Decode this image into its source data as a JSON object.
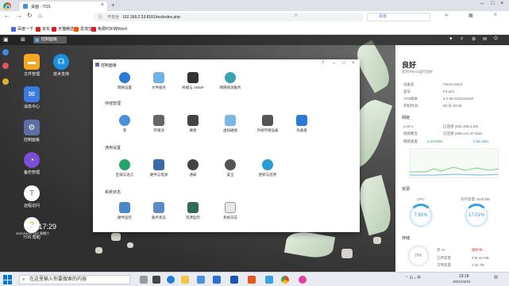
{
  "browser": {
    "tab_title": "桌面 - TOS",
    "security": "不安全",
    "url": "192.168.2.53:8181/tos/index.php",
    "search_placeholder": "百度",
    "bookmarks": [
      "百度一下",
      "京东",
      "天猫精选",
      "爱淘宝",
      "免费PDF转Word"
    ]
  },
  "os": {
    "open_app": "控制面板",
    "clock": "23:17:29",
    "date": "2021/04/24 CST 星期六",
    "desktop_icons": [
      {
        "label": "文件管理",
        "color": "#f5a623"
      },
      {
        "label": "技术支持",
        "color": "#1a8fe0"
      },
      {
        "label": "消息中心",
        "color": "#3a7be0"
      },
      {
        "label": "控制面板",
        "color": "#5b6fa6"
      },
      {
        "label": "备份管理",
        "color": "#7c4fd6"
      },
      {
        "label": "远程访问",
        "color": "#1e88e5"
      },
      {
        "label": "TOS 帮助",
        "color": "#f0c419"
      }
    ]
  },
  "control_panel": {
    "title": "控制面板",
    "sections": [
      {
        "title": "存储管理",
        "items": [
          "卷",
          "存储池",
          "硬盘",
          "虚拟磁盘",
          "外接存储设备",
          "热备盘"
        ]
      },
      {
        "title": "通用设置",
        "items": [
          "区域与语言",
          "硬件与电源",
          "通知",
          "安全",
          "更新与还原"
        ]
      },
      {
        "title": "系统状态",
        "items": [
          "硬件监控",
          "服务状态",
          "资源监控",
          "系统日志"
        ]
      }
    ],
    "top_items": [
      "网络设置",
      "文件服务",
      "终端与 SNMP",
      "网络探测服务"
    ]
  },
  "status_panel": {
    "title": "良好",
    "subtitle": "您的TNAS运行良好",
    "info": [
      {
        "k": "设备名",
        "v": "TNAS-D32A"
      },
      {
        "k": "型号",
        "v": "F2-221"
      },
      {
        "k": "TOS版本",
        "v": "4.2.06-2101111540"
      },
      {
        "k": "开机时间",
        "v": "00 天 00:06"
      }
    ],
    "network_title": "网络",
    "lan": [
      {
        "k": "LAN 1",
        "v": "已连接 (192.168.2.53)"
      },
      {
        "k": "链接聚合",
        "v": "已连接 (186.141.37.224)"
      }
    ],
    "rate_label": "网络速度",
    "up": "5.29 KB/s",
    "down": "0.65 KB/s",
    "resource_title": "资源",
    "cpu_label": "CPU",
    "cpu": "7.81%",
    "mem_label": "内存容量 2048 MB",
    "mem": "17.01%",
    "storage_title": "存储",
    "vol_name": "卷 #1",
    "vol_status": "保护中...",
    "used_label": "已用容量",
    "used": "448.32 MB",
    "free_label": "可用容量",
    "free": "3.56 TB",
    "vol_pct": "0%"
  },
  "taskbar": {
    "search": "在这里输入你要搜索的内容",
    "time": "23:18",
    "date": "2021/04/24"
  }
}
